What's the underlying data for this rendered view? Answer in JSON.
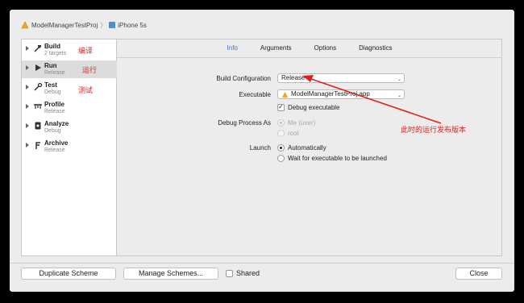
{
  "breadcrumb": {
    "scheme": "ModelManagerTestProj",
    "destination": "iPhone 5s"
  },
  "sidebar": {
    "items": [
      {
        "name": "Build",
        "sub": "2 targets",
        "annotation": "编译"
      },
      {
        "name": "Run",
        "sub": "Release",
        "annotation": "运行"
      },
      {
        "name": "Test",
        "sub": "Debug",
        "annotation": "测试"
      },
      {
        "name": "Profile",
        "sub": "Release"
      },
      {
        "name": "Analyze",
        "sub": "Debug"
      },
      {
        "name": "Archive",
        "sub": "Release"
      }
    ]
  },
  "tabs": [
    "Info",
    "Arguments",
    "Options",
    "Diagnostics"
  ],
  "info": {
    "build_config_label": "Build Configuration",
    "build_config_value": "Release",
    "executable_label": "Executable",
    "executable_value": "ModelManagerTestProj.app",
    "debug_executable_label": "Debug executable",
    "debug_process_label": "Debug Process As",
    "me_user": "Me (user)",
    "root": "root",
    "launch_label": "Launch",
    "automatically": "Automatically",
    "wait_label": "Wait for executable to be launched"
  },
  "annotation_release": "此时的运行发布版本",
  "footer": {
    "duplicate": "Duplicate Scheme",
    "manage": "Manage Schemes...",
    "shared": "Shared",
    "close": "Close"
  },
  "colors": {
    "accent": "#2a7ae2",
    "annotation": "#e02020"
  }
}
